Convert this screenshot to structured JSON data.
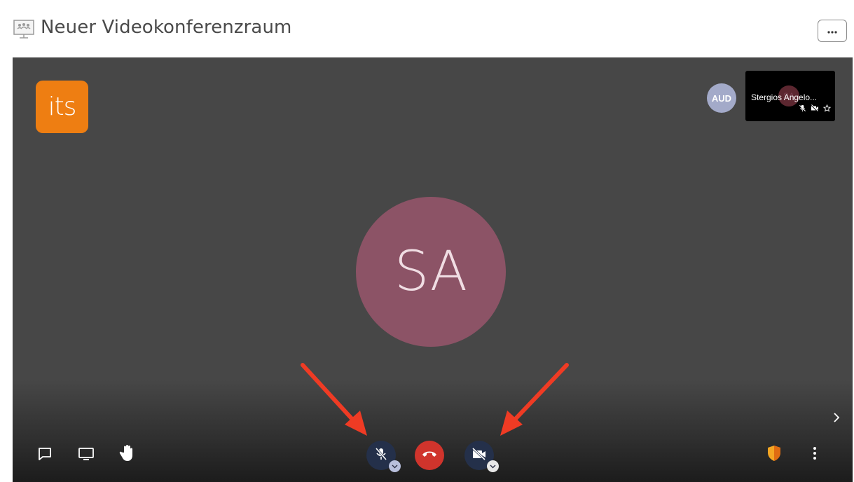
{
  "header": {
    "room_icon": "conference-room-icon",
    "title": "Neuer Videokonferenzraum",
    "more_icon": "ellipsis-icon"
  },
  "stage": {
    "logo_text": "its",
    "participant_badge": "AUD",
    "thumbnail": {
      "name": "Stergios Angelo...",
      "avatar_initials": "SA",
      "icons": [
        "mic-muted-icon",
        "camera-off-icon",
        "star-icon"
      ]
    },
    "main_avatar_initials": "SA",
    "side_panel_icon": "chevron-right-icon"
  },
  "toolbar": {
    "left": [
      "chat-icon",
      "screen-share-icon",
      "raise-hand-icon"
    ],
    "center": [
      "mic-muted-icon",
      "hangup-icon",
      "camera-off-icon"
    ],
    "right": [
      "security-shield-icon",
      "more-vertical-icon"
    ]
  },
  "colors": {
    "stage_bg": "#474747",
    "logo": "#ee7e12",
    "avatar": "#8c5366",
    "hangup": "#d0342c",
    "control_bg": "#24304a",
    "shield": "#f5a623",
    "annotation_arrow": "#ef3b24",
    "aud_badge": "#a3aac9"
  },
  "annotations": [
    "arrow-to-microphone-button",
    "arrow-to-camera-button"
  ]
}
